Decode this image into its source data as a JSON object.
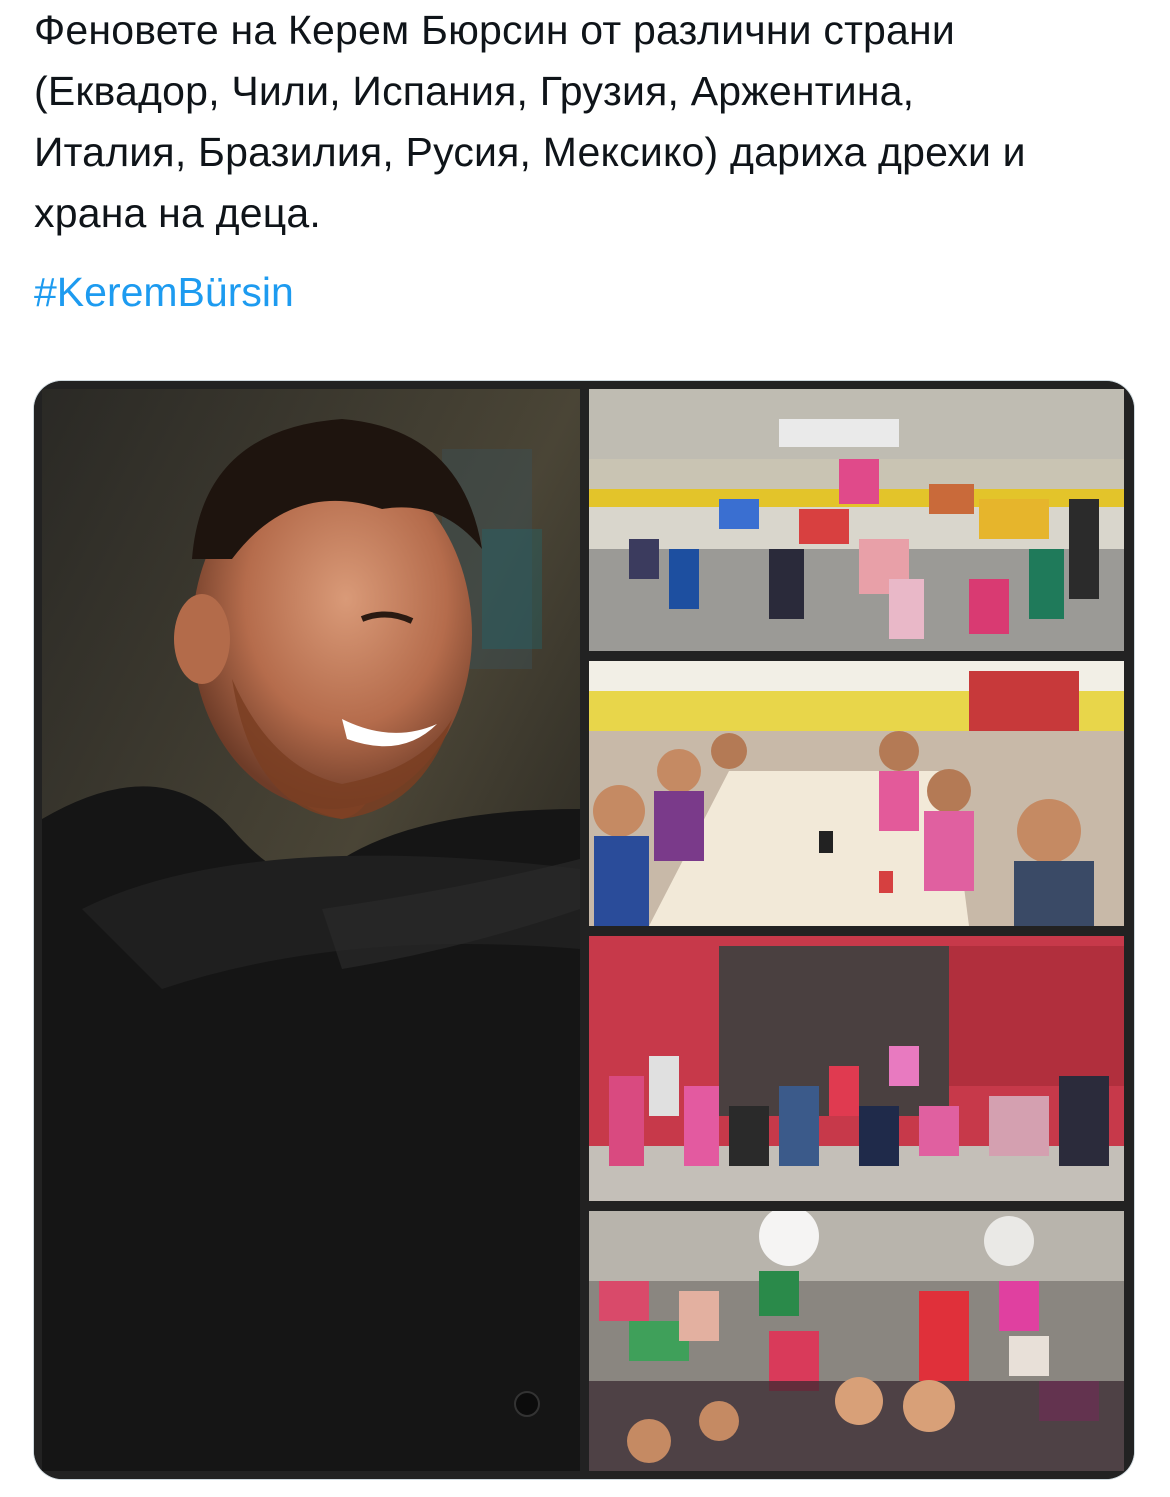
{
  "tweet": {
    "text_lines": [
      "Феновете на Керем Бюрсин от различни страни",
      "(Еквадор, Чили, Испания, Грузия, Аржентина,",
      "Италия, Бразилия, Русия, Мексико) дариха дрехи и",
      "храна на деца."
    ],
    "hashtag": "#KeremBürsin"
  },
  "colors": {
    "text": "#0f1419",
    "link": "#1d9bf0",
    "card_border": "#cfd9de"
  }
}
